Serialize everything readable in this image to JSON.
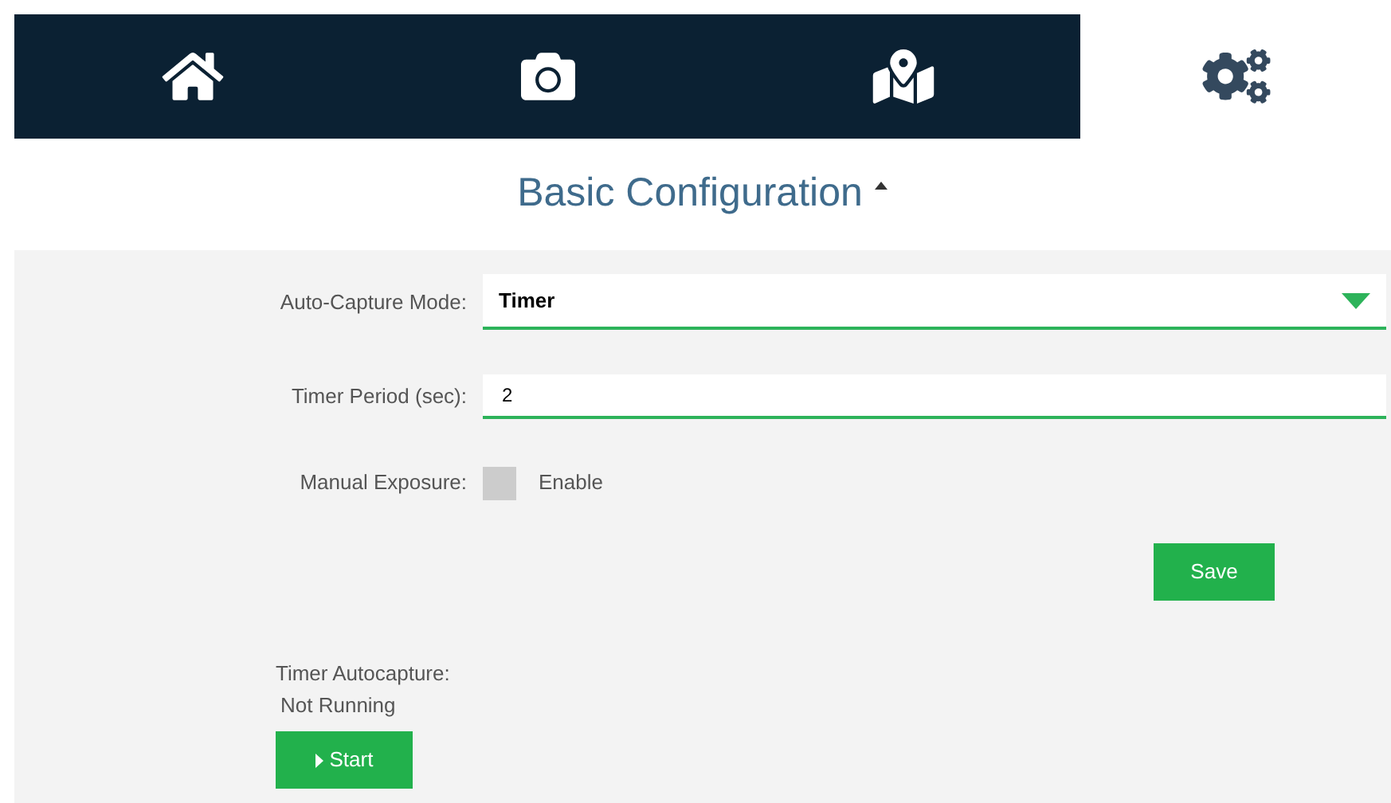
{
  "tabs": [
    {
      "kind": "home",
      "selected": false
    },
    {
      "kind": "camera",
      "selected": false
    },
    {
      "kind": "map",
      "selected": false
    },
    {
      "kind": "settings",
      "selected": true
    }
  ],
  "section": {
    "title": "Basic Configuration",
    "expanded": true
  },
  "form": {
    "auto_capture_mode": {
      "label": "Auto-Capture Mode:",
      "value": "Timer"
    },
    "timer_period": {
      "label": "Timer Period (sec):",
      "value": "2"
    },
    "manual_exposure": {
      "label": "Manual Exposure:",
      "checked": false,
      "option": "Enable"
    },
    "save_button": "Save"
  },
  "timer_autocapture": {
    "label": "Timer Autocapture:",
    "status": "Not Running",
    "button": "Start"
  }
}
